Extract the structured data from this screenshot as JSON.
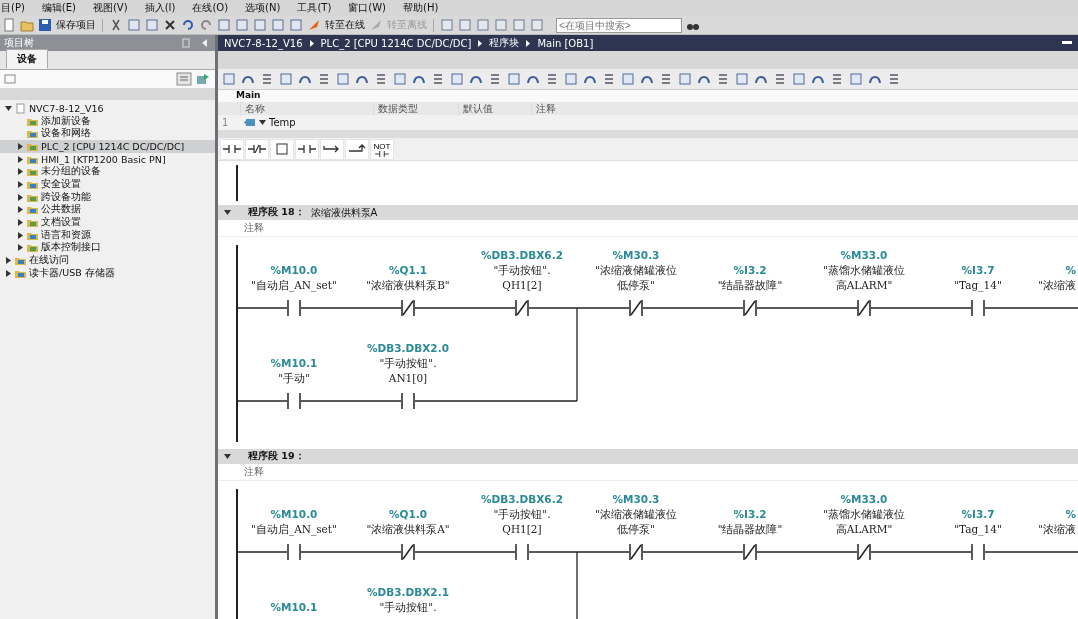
{
  "menu": [
    "目(P)",
    "编辑(E)",
    "视图(V)",
    "插入(I)",
    "在线(O)",
    "选项(N)",
    "工具(T)",
    "窗口(W)",
    "帮助(H)"
  ],
  "toolbar": {
    "save_label": "保存项目",
    "online": {
      "label": "转至在线",
      "disabled": false
    },
    "offline": {
      "label": "转至离线",
      "disabled": true
    },
    "search": {
      "placeholder": "<在项目中搜索>"
    }
  },
  "project_tree": {
    "title": "项目树",
    "tabs": [
      {
        "label": "设备",
        "selected": true
      }
    ],
    "items": [
      {
        "label": "NVC7-8-12_V16",
        "expanded": true,
        "selected": false,
        "children": [
          {
            "label": "添加新设备",
            "selected": false
          },
          {
            "label": "设备和网络",
            "selected": false
          },
          {
            "label": "PLC_2 [CPU 1214C DC/DC/DC]",
            "expanded": false,
            "selected": true
          },
          {
            "label": "HMI_1 [KTP1200 Basic PN]",
            "expanded": false,
            "selected": false
          },
          {
            "label": "未分组的设备",
            "expanded": false,
            "selected": false
          },
          {
            "label": "安全设置",
            "expanded": false,
            "selected": false
          },
          {
            "label": "跨设备功能",
            "expanded": false,
            "selected": false
          },
          {
            "label": "公共数据",
            "expanded": false,
            "selected": false
          },
          {
            "label": "文档设置",
            "expanded": false,
            "selected": false
          },
          {
            "label": "语言和资源",
            "expanded": false,
            "selected": false
          },
          {
            "label": "版本控制接口",
            "expanded": false,
            "selected": false
          }
        ]
      },
      {
        "label": "在线访问",
        "expanded": false,
        "selected": false
      },
      {
        "label": "读卡器/USB 存储器",
        "expanded": false,
        "selected": false
      }
    ]
  },
  "breadcrumb": [
    "NVC7-8-12_V16",
    "PLC_2 [CPU 1214C DC/DC/DC]",
    "程序块",
    "Main [OB1]"
  ],
  "interface": {
    "title": "Main",
    "columns": [
      "名称",
      "数据类型",
      "默认值",
      "注释"
    ],
    "rows": [
      {
        "number": "1",
        "name": "Temp",
        "expanded": true
      }
    ]
  },
  "favorites": [
    {
      "kind": "no"
    },
    {
      "kind": "nc"
    },
    {
      "kind": "box"
    },
    {
      "kind": "no"
    },
    {
      "kind": "open-branch"
    },
    {
      "kind": "close-branch"
    },
    {
      "kind": "not",
      "label": "NOT"
    }
  ],
  "networks": [
    {
      "label": "程序段 18：",
      "title": "浓缩液供料泵A",
      "comment": "注释",
      "rows": [
        [
          {
            "kind": "no",
            "address": "%M10.0",
            "tag": [
              "\"自动启_AN_set\""
            ]
          },
          {
            "kind": "nc",
            "address": "%Q1.1",
            "tag": [
              "\"浓缩液供料泵B\""
            ]
          },
          {
            "kind": "nc",
            "address": "%DB3.DBX6.2",
            "tag": [
              "\"手动按钮\".",
              "QH1[2]"
            ]
          },
          {
            "kind": "nc",
            "address": "%M30.3",
            "tag": [
              "\"浓缩液储罐液位",
              "低停泵\""
            ]
          },
          {
            "kind": "nc",
            "address": "%I3.2",
            "tag": [
              "\"结晶器故障\""
            ]
          },
          {
            "kind": "nc",
            "address": "%M33.0",
            "tag": [
              "\"蒸馏水储罐液位",
              "高ALARM\""
            ]
          },
          {
            "kind": "no",
            "address": "%I3.7",
            "tag": [
              "\"Tag_14\""
            ]
          },
          {
            "kind": "cut",
            "address": "%",
            "tag": [
              "\"浓缩液"
            ]
          }
        ],
        [
          {
            "kind": "no",
            "address": "%M10.1",
            "tag": [
              "\"手动\""
            ]
          },
          {
            "kind": "no",
            "address": "%DB3.DBX2.0",
            "tag": [
              "\"手动按钮\".",
              "AN1[0]"
            ]
          }
        ]
      ]
    },
    {
      "label": "程序段 19：",
      "comment": "注释",
      "rows": [
        [
          {
            "kind": "no",
            "address": "%M10.0",
            "tag": [
              "\"自动启_AN_set\""
            ]
          },
          {
            "kind": "nc",
            "address": "%Q1.0",
            "tag": [
              "\"浓缩液供料泵A\""
            ]
          },
          {
            "kind": "no",
            "address": "%DB3.DBX6.2",
            "tag": [
              "\"手动按钮\".",
              "QH1[2]"
            ]
          },
          {
            "kind": "nc",
            "address": "%M30.3",
            "tag": [
              "\"浓缩液储罐液位",
              "低停泵\""
            ]
          },
          {
            "kind": "nc",
            "address": "%I3.2",
            "tag": [
              "\"结晶器故障\""
            ]
          },
          {
            "kind": "nc",
            "address": "%M33.0",
            "tag": [
              "\"蒸馏水储罐液位",
              "高ALARM\""
            ]
          },
          {
            "kind": "no",
            "address": "%I3.7",
            "tag": [
              "\"Tag_14\""
            ]
          },
          {
            "kind": "cut",
            "address": "%",
            "tag": [
              "\"浓缩液"
            ]
          }
        ],
        [
          {
            "kind": "hidden",
            "address": "%M10.1"
          },
          {
            "kind": "hidden",
            "address": "%DB3.DBX2.1",
            "tag": [
              "\"手动按钮\"."
            ]
          }
        ]
      ]
    }
  ]
}
